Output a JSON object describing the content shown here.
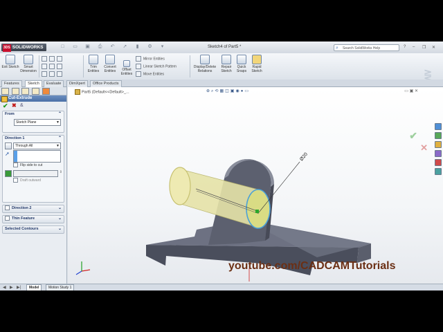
{
  "app": {
    "logo": "SOLIDWORKS",
    "logo_prefix": "3DS",
    "window_title": "Sketch4 of Part5 *",
    "search_placeholder": "Search SolidWorks Help"
  },
  "ribbon": {
    "exit_sketch": "Exit Sketch",
    "smart_dimension": "Smart Dimension",
    "trim_entities": "Trim Entities",
    "convert_entities": "Convert Entities",
    "offset_entities": "Offset Entities",
    "mirror_entities": "Mirror Entities",
    "linear_sketch_pattern": "Linear Sketch Pattern",
    "move_entities": "Move Entities",
    "display_delete_relations": "Display/Delete Relations",
    "repair_sketch": "Repair Sketch",
    "quick_snaps": "Quick Snaps",
    "rapid_sketch": "Rapid Sketch"
  },
  "command_tabs": [
    "Features",
    "Sketch",
    "Evaluate",
    "DimXpert",
    "Office Products"
  ],
  "property_manager": {
    "title": "Cut-Extrude",
    "from_label": "From",
    "from_value": "Sketch Plane",
    "direction1_label": "Direction 1",
    "end_condition": "Through All",
    "flip_side_label": "Flip side to cut",
    "draft_outward_label": "Draft outward",
    "direction2_label": "Direction 2",
    "thin_feature_label": "Thin Feature",
    "selected_contours_label": "Selected Contours"
  },
  "graphics": {
    "tree_item": "Part5  (Default<<Default>_...",
    "dimension": "Ø20",
    "watermark": "youtube.com/CADCAMTutorials"
  },
  "bottom_tabs": [
    "Model",
    "Motion Study 1"
  ]
}
